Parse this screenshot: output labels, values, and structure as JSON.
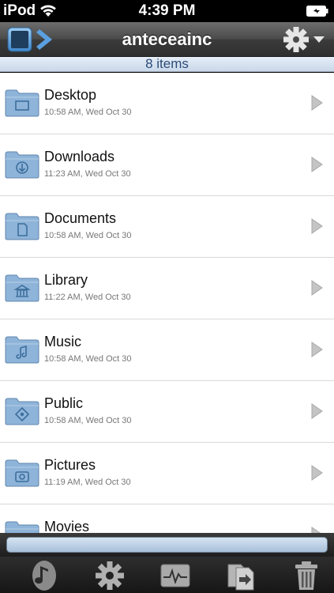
{
  "status_bar": {
    "carrier": "iPod",
    "time": "4:39 PM"
  },
  "nav": {
    "title": "anteceainc"
  },
  "count_label": "8  items",
  "files": [
    {
      "name": "Desktop",
      "date": "10:58 AM, Wed Oct 30",
      "icon": "desktop-folder-icon"
    },
    {
      "name": "Downloads",
      "date": "11:23 AM, Wed Oct 30",
      "icon": "downloads-folder-icon"
    },
    {
      "name": "Documents",
      "date": "10:58 AM, Wed Oct 30",
      "icon": "documents-folder-icon"
    },
    {
      "name": "Library",
      "date": "11:22 AM, Wed Oct 30",
      "icon": "library-folder-icon"
    },
    {
      "name": "Music",
      "date": "10:58 AM, Wed Oct 30",
      "icon": "music-folder-icon"
    },
    {
      "name": "Public",
      "date": "10:58 AM, Wed Oct 30",
      "icon": "public-folder-icon"
    },
    {
      "name": "Pictures",
      "date": "11:19 AM, Wed Oct 30",
      "icon": "pictures-folder-icon"
    },
    {
      "name": "Movies",
      "date": "",
      "icon": "movies-folder-icon"
    }
  ],
  "tabs": [
    {
      "name": "music-note-icon"
    },
    {
      "name": "settings-gear-icon"
    },
    {
      "name": "activity-monitor-icon"
    },
    {
      "name": "transfer-files-icon"
    },
    {
      "name": "trash-icon"
    }
  ],
  "colors": {
    "folder": "#8fb4d9",
    "accent": "#5aa0e0"
  }
}
